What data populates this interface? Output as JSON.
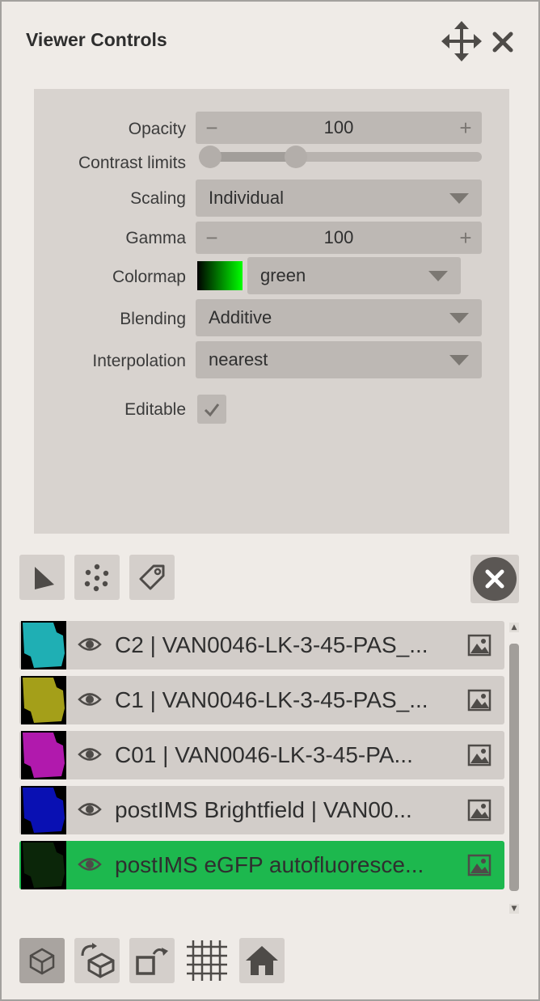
{
  "panel": {
    "title": "Viewer Controls",
    "title_icons": [
      "move-icon",
      "close-icon"
    ]
  },
  "controls": {
    "opacity": {
      "label": "Opacity",
      "value": "100",
      "minus": "−",
      "plus": "+"
    },
    "contrast": {
      "label": "Contrast limits",
      "low": 0.0,
      "high": 0.33
    },
    "scaling": {
      "label": "Scaling",
      "value": "Individual"
    },
    "gamma": {
      "label": "Gamma",
      "value": "100",
      "minus": "−",
      "plus": "+"
    },
    "colormap": {
      "label": "Colormap",
      "value": "green",
      "swatch_from": "#000000",
      "swatch_to": "#00ff00"
    },
    "blending": {
      "label": "Blending",
      "value": "Additive"
    },
    "interpolation": {
      "label": "Interpolation",
      "value": "nearest"
    },
    "editable": {
      "label": "Editable",
      "checked": true
    }
  },
  "toolbar": {
    "tools": [
      "shapes-icon",
      "points-icon",
      "label-icon"
    ],
    "delete": "close-circle-icon"
  },
  "layers": [
    {
      "name": "C2 | VAN0046-LK-3-45-PAS_...",
      "color": "#22c2c8",
      "visible": true,
      "selected": false
    },
    {
      "name": "C1 | VAN0046-LK-3-45-PAS_...",
      "color": "#b6b01c",
      "visible": true,
      "selected": false
    },
    {
      "name": "C01 | VAN0046-LK-3-45-PA...",
      "color": "#c41cc0",
      "visible": true,
      "selected": false
    },
    {
      "name": "postIMS Brightfield | VAN00...",
      "color": "#0a12c6",
      "visible": true,
      "selected": false
    },
    {
      "name": "postIMS eGFP autofluoresce...",
      "color": "#0c2a0a",
      "visible": true,
      "selected": true
    }
  ],
  "bottom_bar": [
    "ndisplay-icon",
    "roll-icon",
    "transpose-icon",
    "grid-icon",
    "home-icon"
  ],
  "colors": {
    "selected": "#1db84e",
    "panel": "#efebe7",
    "controls": "#d8d3cf"
  }
}
